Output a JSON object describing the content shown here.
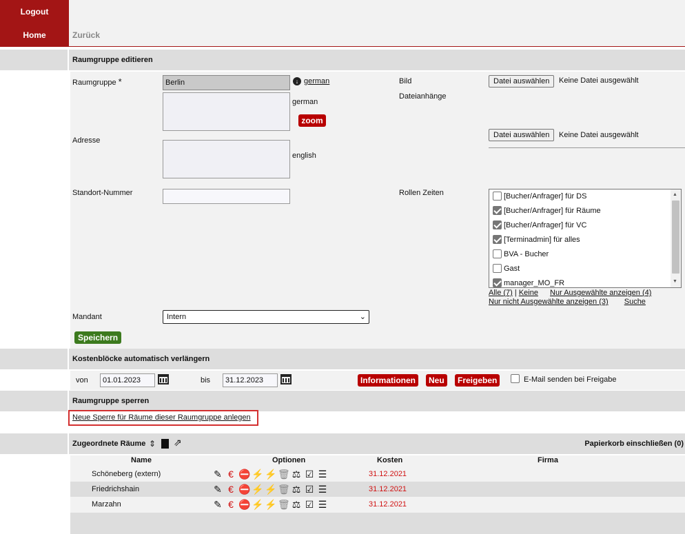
{
  "nav": {
    "logout": "Logout",
    "home": "Home",
    "back": "Zurück"
  },
  "edit_section": {
    "title": "Raumgruppe editieren"
  },
  "form": {
    "raumgruppe_label": "Raumgruppe",
    "required_mark": "*",
    "raumgruppe_value": "Berlin",
    "lang_link": "german",
    "lang_german": "german",
    "zoom_button": "zoom",
    "adresse_label": "Adresse",
    "lang_english": "english",
    "standort_label": "Standort-Nummer",
    "bild_label": "Bild",
    "anhaenge_label": "Dateianhänge",
    "file_button": "Datei auswählen",
    "file_none": "Keine Datei ausgewählt",
    "rollen_label": "Rollen Zeiten",
    "rollen": [
      {
        "label": "[Bucher/Anfrager] für DS",
        "checked": false
      },
      {
        "label": "[Bucher/Anfrager] für Räume",
        "checked": true
      },
      {
        "label": "[Bucher/Anfrager] für VC",
        "checked": true
      },
      {
        "label": "[Terminadmin] für alles",
        "checked": true
      },
      {
        "label": "BVA - Bucher",
        "checked": false
      },
      {
        "label": "Gast",
        "checked": false
      },
      {
        "label": "manager_MO_FR",
        "checked": true
      }
    ],
    "rollen_links": {
      "all": "Alle (7)",
      "separator": "|",
      "none": "Keine",
      "only_selected": "Nur Ausgewählte anzeigen (4)",
      "only_unselected": "Nur nicht Ausgewählte anzeigen (3)",
      "search": "Suche"
    },
    "mandant_label": "Mandant",
    "mandant_value": "Intern",
    "save_button": "Speichern"
  },
  "kosten": {
    "title": "Kostenblöcke automatisch verlängern",
    "from_label": "von",
    "from_value": "01.01.2023",
    "to_label": "bis",
    "to_value": "31.12.2023",
    "info_button": "Informationen",
    "new_button": "Neu",
    "release_button": "Freigeben",
    "email_label": "E-Mail senden bei Freigabe"
  },
  "sperren": {
    "title": "Raumgruppe sperren",
    "new_link": "Neue Sperre für Räume dieser Raumgruppe anlegen"
  },
  "rooms": {
    "title": "Zugeordnete Räume",
    "trash_label": "Papierkorb einschließen (0)",
    "headers": {
      "name": "Name",
      "options": "Optionen",
      "cost": "Kosten",
      "company": "Firma"
    },
    "rows": [
      {
        "name": "Schöneberg (extern)",
        "cost": "31.12.2021"
      },
      {
        "name": "Friedrichshain",
        "cost": "31.12.2021"
      },
      {
        "name": "Marzahn",
        "cost": "31.12.2021"
      }
    ]
  },
  "colors": {
    "brand_red": "#a31515",
    "save_green": "#3c7a1e",
    "date_red": "#d01010",
    "highlight_border": "#d32f2f"
  }
}
